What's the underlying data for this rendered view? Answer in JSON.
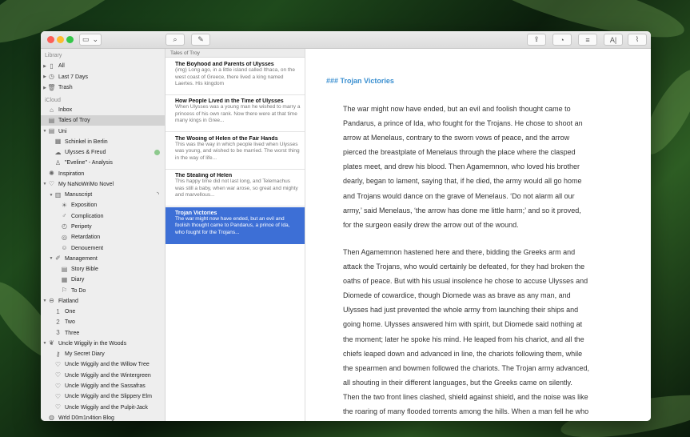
{
  "window": {
    "toolbar": {
      "sidebar_toggle": "▭",
      "dropdown": "⌄",
      "search": "⌕",
      "compose": "✎",
      "share": "⇪",
      "stats": "◔",
      "list": "≡",
      "typography": "A|",
      "attach": "⌇"
    }
  },
  "sidebar": {
    "sections": [
      "Library",
      "iCloud"
    ],
    "rows": [
      {
        "label": "All",
        "icon": "▯",
        "tri": "▶",
        "indent": 0,
        "selected": false
      },
      {
        "label": "Last 7 Days",
        "icon": "◷",
        "tri": "▶",
        "indent": 0,
        "selected": false
      },
      {
        "label": "Trash",
        "icon": "🗑",
        "tri": "▶",
        "indent": 0,
        "selected": false
      },
      {
        "label": "Inbox",
        "icon": "⌂",
        "tri": "",
        "indent": 0,
        "selected": false
      },
      {
        "label": "Tales of Troy",
        "icon": "▤",
        "tri": "",
        "indent": 0,
        "selected": true
      },
      {
        "label": "Uni",
        "icon": "▤",
        "tri": "▼",
        "indent": 0,
        "selected": false
      },
      {
        "label": "Schinkel in Berlin",
        "icon": "▦",
        "tri": "",
        "indent": 1,
        "selected": false
      },
      {
        "label": "Ulysses & Freud",
        "icon": "☁",
        "tri": "",
        "indent": 1,
        "selected": false,
        "badge": true
      },
      {
        "label": "\"Eveline\" - Analysis",
        "icon": "♙",
        "tri": "",
        "indent": 1,
        "selected": false
      },
      {
        "label": "Inspiration",
        "icon": "✺",
        "tri": "",
        "indent": 0,
        "selected": false
      },
      {
        "label": "My NaNoWriMo Novel",
        "icon": "♡",
        "tri": "▼",
        "indent": 0,
        "selected": false
      },
      {
        "label": "Manuscript",
        "icon": "▥",
        "tri": "▼",
        "indent": 1,
        "selected": false,
        "spin": true
      },
      {
        "label": "Exposition",
        "icon": "☀",
        "tri": "",
        "indent": 2,
        "selected": false
      },
      {
        "label": "Complication",
        "icon": "♂",
        "tri": "",
        "indent": 2,
        "selected": false
      },
      {
        "label": "Peripety",
        "icon": "◴",
        "tri": "",
        "indent": 2,
        "selected": false
      },
      {
        "label": "Retardation",
        "icon": "◎",
        "tri": "",
        "indent": 2,
        "selected": false
      },
      {
        "label": "Denouement",
        "icon": "☺",
        "tri": "",
        "indent": 2,
        "selected": false
      },
      {
        "label": "Management",
        "icon": "✐",
        "tri": "▼",
        "indent": 1,
        "selected": false
      },
      {
        "label": "Story Bible",
        "icon": "▤",
        "tri": "",
        "indent": 2,
        "selected": false
      },
      {
        "label": "Diary",
        "icon": "▦",
        "tri": "",
        "indent": 2,
        "selected": false
      },
      {
        "label": "To Do",
        "icon": "⚐",
        "tri": "",
        "indent": 2,
        "selected": false
      },
      {
        "label": "Flatland",
        "icon": "⊖",
        "tri": "▼",
        "indent": 0,
        "selected": false
      },
      {
        "label": "One",
        "icon": "1",
        "tri": "",
        "indent": 1,
        "selected": false
      },
      {
        "label": "Two",
        "icon": "2",
        "tri": "",
        "indent": 1,
        "selected": false
      },
      {
        "label": "Three",
        "icon": "3",
        "tri": "",
        "indent": 1,
        "selected": false
      },
      {
        "label": "Uncle Wiggily in the Woods",
        "icon": "❦",
        "tri": "▼",
        "indent": 0,
        "selected": false
      },
      {
        "label": "My Secret Diary",
        "icon": "⚷",
        "tri": "",
        "indent": 1,
        "selected": false
      },
      {
        "label": "Uncle Wiggily and the Willow Tree",
        "icon": "♡",
        "tri": "",
        "indent": 1,
        "selected": false
      },
      {
        "label": "Uncle Wiggily and the Wintergreen",
        "icon": "♡",
        "tri": "",
        "indent": 1,
        "selected": false
      },
      {
        "label": "Uncle Wiggily and the Sassafras",
        "icon": "♡",
        "tri": "",
        "indent": 1,
        "selected": false
      },
      {
        "label": "Uncle Wiggily and the Slippery Elm",
        "icon": "♡",
        "tri": "",
        "indent": 1,
        "selected": false
      },
      {
        "label": "Uncle Wiggily and the Pulpit-Jack",
        "icon": "♡",
        "tri": "",
        "indent": 1,
        "selected": false
      },
      {
        "label": "Wrld D0m1n4tion Blog",
        "icon": "◍",
        "tri": "",
        "indent": 0,
        "selected": false
      }
    ]
  },
  "note_list": {
    "header": "Tales of Troy",
    "notes": [
      {
        "title": "The Boyhood and Parents of Ulysses",
        "snippet": "(img) Long ago, in a little island called Ithaca, on the west coast of Greece, there lived a king named Laertes. His kingdom",
        "selected": false
      },
      {
        "title": "How People Lived in the Time of Ulysses",
        "snippet": "When Ulysses was a young man he wished to marry a princess of his own rank. Now there were at that time many kings in Gree...",
        "selected": false
      },
      {
        "title": "The Wooing of Helen of the Fair Hands",
        "snippet": "This was the way in which people lived when Ulysses was young, and wished to be married. The worst thing in the way of life...",
        "selected": false
      },
      {
        "title": "The Stealing of Helen",
        "snippet": "This happy time did not last long, and Telemachus was still a baby, when war arose, so great and mighty and marvellous...",
        "selected": false
      },
      {
        "title": "Trojan Victories",
        "snippet": "The war might now have ended, but an evil and foolish thought came to Pandarus, a prince of Ida, who fought for the Trojans...",
        "selected": true
      }
    ]
  },
  "editor": {
    "heading": "### Trojan Victories",
    "paragraphs": [
      "The war might now have ended, but an evil and foolish thought came to\nPandarus, a prince of Ida, who fought for the Trojans. He chose to shoot an\narrow at Menelaus, contrary to the sworn vows of peace, and the arrow\npierced the breastplate of Menelaus through the place where the clasped\nplates meet, and drew his blood. Then Agamemnon, who loved his brother\ndearly, began to lament, saying that, if he died, the army would all go home\nand Trojans would dance on the grave of Menelaus. ‘Do not alarm all our\narmy,’ said Menelaus, ‘the arrow has done me little harm;’ and so it proved,\nfor the surgeon easily drew the arrow out of the wound.",
      "Then Agamemnon hastened here and there, bidding the Greeks arm and\nattack the Trojans, who would certainly be defeated, for they had broken the\noaths of peace. But with his usual insolence he chose to accuse Ulysses and\nDiomede of cowardice, though Diomede was as brave as any man, and\nUlysses had just prevented the whole army from launching their ships and\ngoing home. Ulysses answered him with spirit, but Diomede said nothing at\nthe moment; later he spoke his mind. He leaped from his chariot, and all the\nchiefs leaped down and advanced in line, the chariots following them, while\nthe spearmen and bowmen followed the chariots. The Trojan army advanced,\nall shouting in their different languages, but the Greeks came on silently.\nThen the two front lines clashed, shield against shield, and the noise was like\nthe roaring of many flooded torrents among the hills. When a man fell he who"
    ]
  },
  "colors": {
    "accent": "#3d6fd6",
    "heading": "#3a8fd0",
    "close": "#fc5f57",
    "minimize": "#fdbc2e",
    "zoom": "#33c748"
  }
}
